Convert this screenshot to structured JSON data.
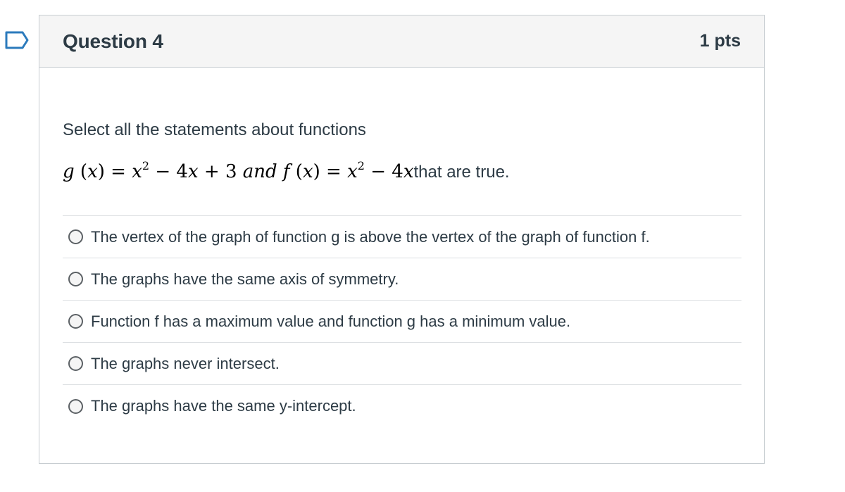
{
  "question": {
    "title": "Question 4",
    "points": "1 pts",
    "prompt_line1": "Select all the statements about functions",
    "formula": {
      "g_lhs": "g",
      "x": "x",
      "eq": "=",
      "sq": "2",
      "g_rest": "− 4",
      "plus3": "+ 3",
      "and": "and",
      "f_lhs": "f",
      "f_rest": "− 4",
      "suffix": "that are true."
    },
    "answers": [
      "The vertex of the graph of function g is above the vertex of the graph of function f.",
      "The graphs have the same axis of symmetry.",
      "Function f has a maximum value and function g has a minimum value.",
      "The graphs never intersect.",
      "The graphs have the same y-intercept."
    ]
  },
  "icons": {
    "flag": "flag-question-icon"
  },
  "colors": {
    "flag_stroke": "#2b7abc",
    "header_bg": "#f5f5f5",
    "text": "#2d3b45"
  }
}
